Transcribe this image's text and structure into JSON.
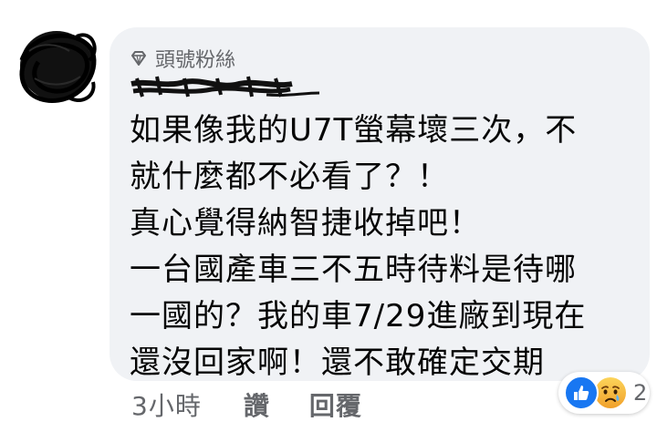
{
  "comment": {
    "badge_label": "頭號粉絲",
    "lines": [
      "如果像我的U7T螢幕壞三次，不",
      "就什麼都不必看了？！",
      "真心覺得納智捷收掉吧！",
      "一台國產車三不五時待料是待哪",
      "一國的？我的車7/29進廠到現在",
      "還沒回家啊！還不敢確定交期"
    ]
  },
  "actions": {
    "time": "3小時",
    "like_label": "讚",
    "reply_label": "回覆"
  },
  "reactions": {
    "count": "2",
    "icons": [
      "like-icon",
      "sad-icon"
    ]
  },
  "colors": {
    "bubble": "#f0f2f5",
    "meta_text": "#65676b",
    "like_blue": "#1877f2",
    "sad_yellow": "#f7b125"
  }
}
